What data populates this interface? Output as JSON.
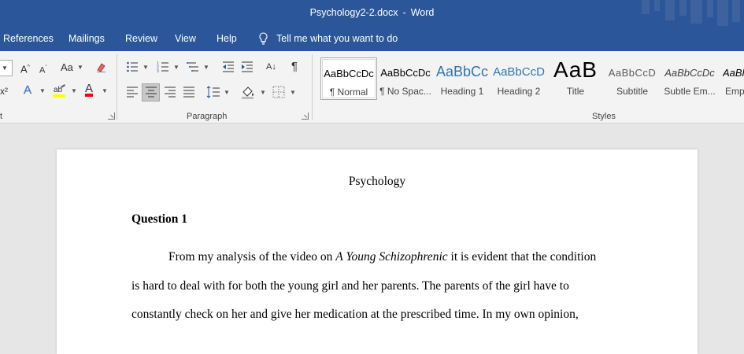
{
  "window": {
    "doc_name": "Psychology2-2.docx",
    "separator": "-",
    "app_name": "Word"
  },
  "tabs": [
    "References",
    "Mailings",
    "Review",
    "View",
    "Help"
  ],
  "tell_me": "Tell me what you want to do",
  "ribbon": {
    "font_group_label": "t",
    "paragraph_label": "Paragraph",
    "styles_label": "Styles",
    "glyphs": {
      "grow_font": "A",
      "shrink_font": "A",
      "change_case": "Aa",
      "superscript": "x²",
      "text_effects": "A",
      "font_color": "A",
      "pilcrow": "¶",
      "sort": "A↓"
    }
  },
  "styles": [
    {
      "sample": "AaBbCcDc",
      "name": "¶ Normal"
    },
    {
      "sample": "AaBbCcDc",
      "name": "¶ No Spac..."
    },
    {
      "sample": "AaBbCc",
      "name": "Heading 1"
    },
    {
      "sample": "AaBbCcD",
      "name": "Heading 2"
    },
    {
      "sample": "AaB",
      "name": "Title"
    },
    {
      "sample": "AaBbCcD",
      "name": "Subtitle"
    },
    {
      "sample": "AaBbCcDc",
      "name": "Subtle Em..."
    },
    {
      "sample": "AaBl",
      "name": "Emp"
    }
  ],
  "document": {
    "title": "Psychology",
    "heading": "Question 1",
    "line1_pre": "From my analysis of the video on ",
    "line1_italic": "A Young Schizophrenic",
    "line1_post": " it is evident that the condition",
    "line2": "is hard to deal with for both the young girl and her parents. The parents of the girl have to",
    "line3": "constantly check on her and give her medication at the prescribed time. In my own opinion,"
  },
  "colors": {
    "brand": "#2b579a",
    "heading_blue": "#2e74b5",
    "highlight_yellow": "#ffff00",
    "font_red": "#ff0000"
  }
}
